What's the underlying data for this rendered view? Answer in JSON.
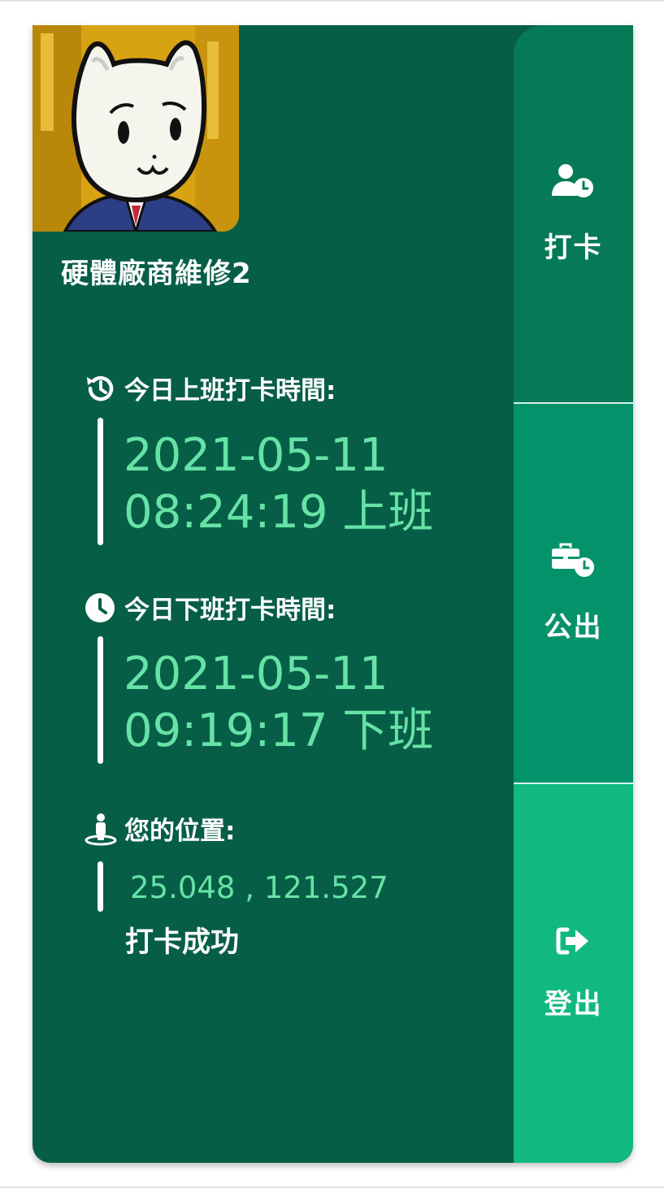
{
  "user": {
    "name": "硬體廠商維修2"
  },
  "checkin": {
    "title": "今日上班打卡時間:",
    "date": "2021-05-11",
    "time_label": "08:24:19 上班"
  },
  "checkout": {
    "title": "今日下班打卡時間:",
    "date": "2021-05-11",
    "time_label": "09:19:17 下班"
  },
  "location": {
    "title": "您的位置:",
    "coords": "25.048 , 121.527",
    "status": "打卡成功"
  },
  "sidebar": {
    "items": [
      {
        "label": "打卡",
        "icon": "user-clock-icon"
      },
      {
        "label": "公出",
        "icon": "briefcase-clock-icon"
      },
      {
        "label": "登出",
        "icon": "sign-out-icon"
      }
    ]
  },
  "colors": {
    "card_bg": "#075e47",
    "accent_text": "#67e2a7",
    "sidebar_checkin": "#067a57",
    "sidebar_out": "#04926a",
    "sidebar_logout": "#11b97f"
  }
}
